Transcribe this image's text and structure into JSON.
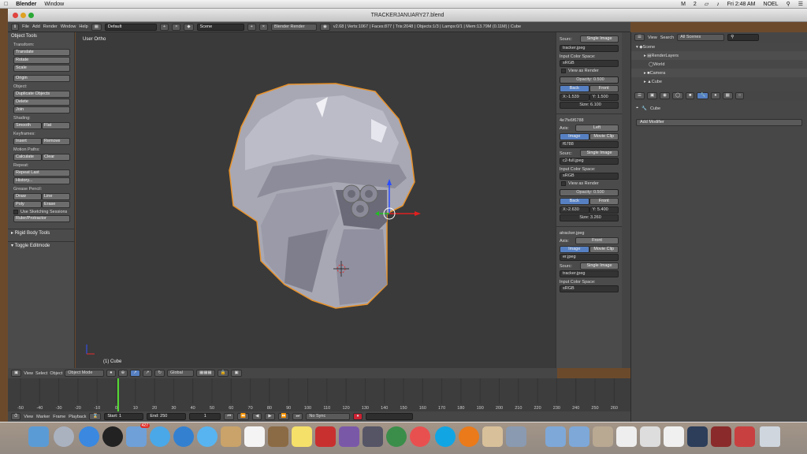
{
  "menubar": {
    "app": "Blender",
    "items": [
      "Window"
    ],
    "status_right": [
      "2",
      "Fri 2:48 AM",
      "NOEL"
    ]
  },
  "window": {
    "title": "TRACKERJANUARY27.blend"
  },
  "info_header": {
    "menus": [
      "File",
      "Add",
      "Render",
      "Window",
      "Help"
    ],
    "layout": "Default",
    "scene": "Scene",
    "engine": "Blender Render",
    "stats": "v2.68 | Verts:1067 | Faces:877 | Tris:2048 | Objects:1/3 | Lamps:0/1 | Mem:13.79M (0.11M) | Cube"
  },
  "toolshelf": {
    "title": "Object Tools",
    "transform_label": "Transform:",
    "transform": [
      "Translate",
      "Rotate",
      "Scale"
    ],
    "origin": "Origin",
    "object_label": "Object:",
    "object": [
      "Duplicate Objects",
      "Delete",
      "Join"
    ],
    "shading_label": "Shading:",
    "shading": [
      "Smooth",
      "Flat"
    ],
    "keyframes_label": "Keyframes:",
    "keyframes": [
      "Insert",
      "Remove"
    ],
    "motion_label": "Motion Paths:",
    "motion": [
      "Calculate",
      "Clear"
    ],
    "repeat_label": "Repeat:",
    "repeat": [
      "Repeat Last",
      "History..."
    ],
    "grease_label": "Grease Pencil:",
    "grease_row1": [
      "Draw",
      "Line"
    ],
    "grease_row2": [
      "Poly",
      "Erase"
    ],
    "sketch": "Use Sketching Sessions",
    "ruler": "Ruler/Protractor",
    "rigid": "Rigid Body Tools",
    "toggle": "Toggle Editmode"
  },
  "viewport": {
    "view_label": "User Ortho",
    "object_label": "(1) Cube"
  },
  "viewport_header": {
    "menus": [
      "View",
      "Select",
      "Object"
    ],
    "mode": "Object Mode",
    "orientation": "Global"
  },
  "bg_images": {
    "panel1": {
      "source_label": "Sourc:",
      "source": "Single Image",
      "file": "tracker.jpeg",
      "color_space_label": "Input Color Space:",
      "color_space": "sRGB",
      "view_render": "View as Render",
      "opacity": "Opacity: 0.500",
      "back": "Back",
      "front": "Front",
      "x": "X:-1.539",
      "y": "Y: 1.500",
      "size": "Size: 6.100"
    },
    "panel2": {
      "name": "4e7fe6f6788",
      "axis_label": "Axis:",
      "axis": "Left",
      "image": "Image",
      "movie": "Movie Clip",
      "file_id": "f6788",
      "source_label": "Sourc:",
      "source": "Single Image",
      "file": "c2-full.jpeg",
      "color_space_label": "Input Color Space:",
      "color_space": "sRGB",
      "view_render": "View as Render",
      "opacity": "Opacity: 0.500",
      "back": "Back",
      "front": "Front",
      "x": "X:-2.630",
      "y": "Y: 5.400",
      "size": "Size: 3.260"
    },
    "panel3": {
      "name": "atracker.jpeg",
      "axis_label": "Axis:",
      "axis": "Front",
      "image": "Image",
      "movie": "Movie Clip",
      "file_id": "er.jpeg",
      "source_label": "Sourc:",
      "source": "Single Image",
      "file": "tracker.jpeg",
      "color_space_label": "Input Color Space:",
      "color_space": "sRGB"
    }
  },
  "outliner": {
    "menus": [
      "View",
      "Search"
    ],
    "filter": "All Scenes",
    "items": [
      "Scene",
      "RenderLayers",
      "World",
      "Camera",
      "Cube"
    ]
  },
  "properties": {
    "context": "Cube",
    "add_modifier": "Add Modifier"
  },
  "timeline": {
    "ticks": [
      "-50",
      "-40",
      "-30",
      "-20",
      "-10",
      "0",
      "10",
      "20",
      "30",
      "40",
      "50",
      "60",
      "70",
      "80",
      "90",
      "100",
      "110",
      "120",
      "130",
      "140",
      "150",
      "160",
      "170",
      "180",
      "190",
      "200",
      "210",
      "220",
      "230",
      "240",
      "250",
      "260"
    ],
    "menus": [
      "View",
      "Marker",
      "Frame",
      "Playback"
    ],
    "start": "Start: 1",
    "end": "End: 250",
    "current": "1",
    "sync": "No Sync"
  },
  "dock": {
    "badge_mail": "427"
  }
}
